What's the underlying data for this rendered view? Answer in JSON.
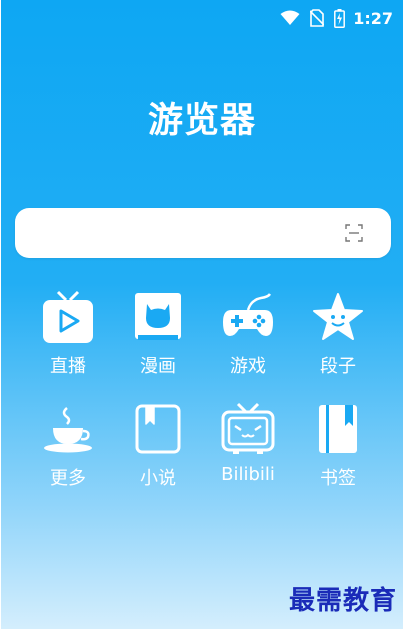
{
  "status_bar": {
    "time": "1:27",
    "icons": [
      "wifi-icon",
      "no-sim-icon",
      "battery-charging-icon"
    ]
  },
  "app": {
    "title": "游览器"
  },
  "search": {
    "placeholder": "",
    "scan_icon": "scan-icon"
  },
  "tiles": [
    {
      "label": "直播",
      "icon": "live-tv-icon"
    },
    {
      "label": "漫画",
      "icon": "comic-book-icon"
    },
    {
      "label": "游戏",
      "icon": "gamepad-icon"
    },
    {
      "label": "段子",
      "icon": "star-face-icon"
    },
    {
      "label": "更多",
      "icon": "coffee-cup-icon"
    },
    {
      "label": "小说",
      "icon": "novel-book-icon"
    },
    {
      "label": "Bilibili",
      "icon": "bilibili-tv-icon"
    },
    {
      "label": "书签",
      "icon": "bookmark-icon"
    }
  ],
  "watermark": "最需教育",
  "colors": {
    "background_top": "#0ea7f3",
    "background_bottom": "#d4eefd",
    "text": "#ffffff",
    "watermark": "#1a2bb8"
  }
}
